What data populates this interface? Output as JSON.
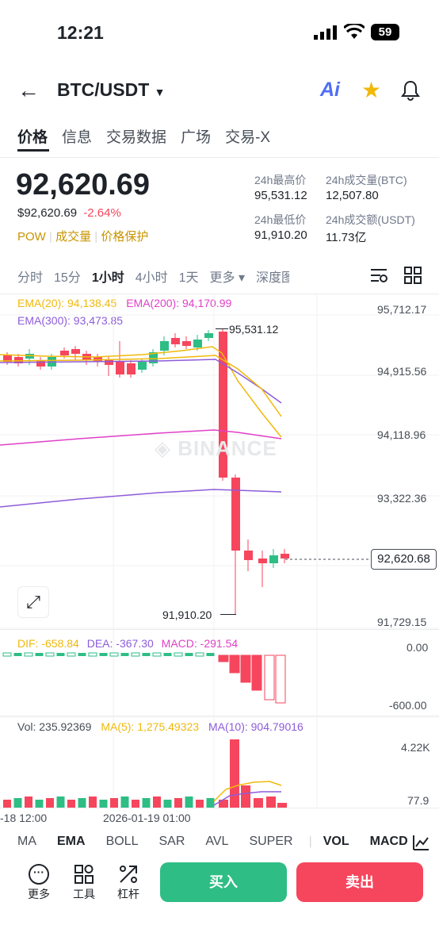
{
  "status_bar": {
    "time": "12:21",
    "battery": "59"
  },
  "header": {
    "pair": "BTC/USDT",
    "ai_label": "Ai"
  },
  "tabs": [
    {
      "label": "价格",
      "active": true
    },
    {
      "label": "信息",
      "active": false
    },
    {
      "label": "交易数据",
      "active": false
    },
    {
      "label": "广场",
      "active": false
    },
    {
      "label": "交易-X",
      "active": false
    }
  ],
  "ticker": {
    "last_price": "92,620.69",
    "usd_price": "$92,620.69",
    "change": "-2.64%",
    "tags": [
      "POW",
      "成交量",
      "价格保护"
    ],
    "high_label": "24h最高价",
    "high_value": "95,531.12",
    "vol_btc_label": "24h成交量(BTC)",
    "vol_btc_value": "12,507.80",
    "low_label": "24h最低价",
    "low_value": "91,910.20",
    "vol_usdt_label": "24h成交额(USDT)",
    "vol_usdt_value": "11.73亿"
  },
  "intervals": [
    {
      "label": "分时",
      "active": false
    },
    {
      "label": "15分",
      "active": false
    },
    {
      "label": "1小时",
      "active": true
    },
    {
      "label": "4小时",
      "active": false
    },
    {
      "label": "1天",
      "active": false
    },
    {
      "label": "更多 ▾",
      "active": false
    },
    {
      "label": "深度图",
      "active": false
    }
  ],
  "main_chart": {
    "ema20": "EMA(20): 94,138.45",
    "ema200": "EMA(200): 94,170.99",
    "ema300": "EMA(300): 93,473.85",
    "y_ticks": [
      "95,712.17",
      "94,915.56",
      "94,118.96",
      "93,322.36",
      "91,729.15"
    ],
    "high_marker": "95,531.12",
    "low_marker": "91,910.20",
    "current_price": "92,620.68",
    "watermark": "BINANCE"
  },
  "macd_chart": {
    "dif": "DIF: -658.84",
    "dea": "DEA: -367.30",
    "macd": "MACD: -291.54",
    "y_ticks": [
      "0.00",
      "-600.00"
    ]
  },
  "vol_chart": {
    "vol": "Vol: 235.92369",
    "ma5": "MA(5): 1,275.49323",
    "ma10": "MA(10): 904.79016",
    "y_ticks": [
      "4.22K",
      "77.9"
    ]
  },
  "x_axis": [
    "-18 12:00",
    "2026-01-19 01:00"
  ],
  "indicators": [
    {
      "label": "MA",
      "active": false
    },
    {
      "label": "EMA",
      "active": true
    },
    {
      "label": "BOLL",
      "active": false
    },
    {
      "label": "SAR",
      "active": false
    },
    {
      "label": "AVL",
      "active": false
    },
    {
      "label": "SUPER",
      "active": false
    },
    {
      "label": "VOL",
      "active": true
    },
    {
      "label": "MACD",
      "active": true
    }
  ],
  "tools": [
    {
      "label": "更多",
      "icon": "more-icon"
    },
    {
      "label": "工具",
      "icon": "tools-icon"
    },
    {
      "label": "杠杆",
      "icon": "leverage-icon"
    }
  ],
  "actions": {
    "buy": "买入",
    "sell": "卖出"
  },
  "colors": {
    "up": "#2ebd85",
    "down": "#f6465d",
    "ema20": "#f0b90b",
    "ema200": "#e040c8",
    "ema300": "#8e5cd9"
  }
}
